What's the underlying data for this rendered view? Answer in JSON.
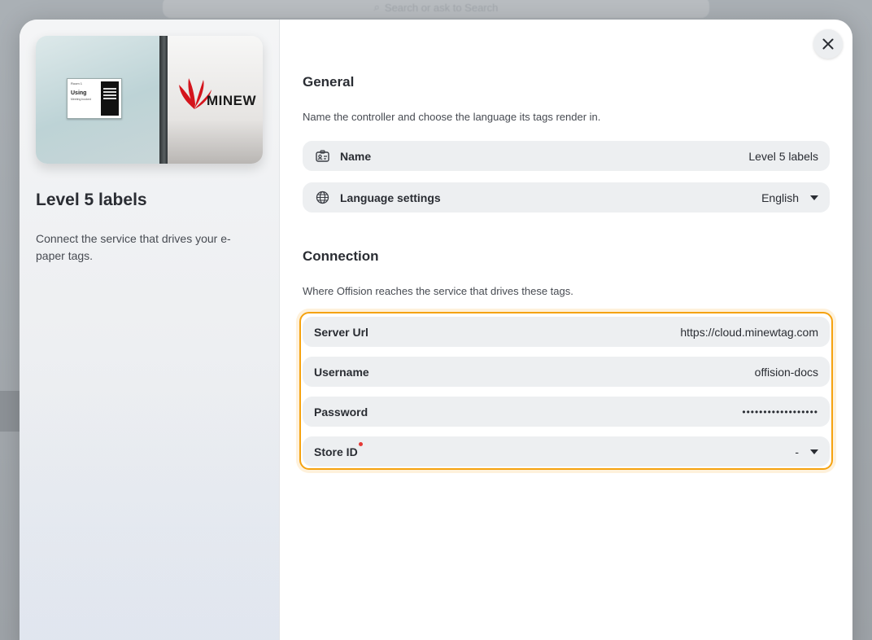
{
  "background": {
    "search_placeholder": "Search or ask to Search"
  },
  "sidebar": {
    "title": "Level 5 labels",
    "description": "Connect the service that drives your e-paper tags.",
    "hero": {
      "tag_header": "Room 1",
      "tag_status": "Using",
      "tag_subtext": "Meeting booked",
      "brand_name": "MINEW"
    }
  },
  "general": {
    "title": "General",
    "description": "Name the controller and choose the language its tags render in.",
    "name_row": {
      "label": "Name",
      "value": "Level 5 labels",
      "icon": "id-card-icon"
    },
    "language_row": {
      "label": "Language settings",
      "value": "English",
      "icon": "globe-icon"
    }
  },
  "connection": {
    "title": "Connection",
    "description": "Where Offision reaches the service that drives these tags.",
    "server_url": {
      "label": "Server Url",
      "value": "https://cloud.minewtag.com"
    },
    "username": {
      "label": "Username",
      "value": "offision-docs"
    },
    "password": {
      "label": "Password",
      "value": "••••••••••••••••••"
    },
    "store_id": {
      "label": "Store ID",
      "value": "-",
      "required": true
    }
  },
  "colors": {
    "accent_outline": "#f5a20f",
    "required_dot": "#e53935",
    "brand_red": "#d4141c"
  }
}
